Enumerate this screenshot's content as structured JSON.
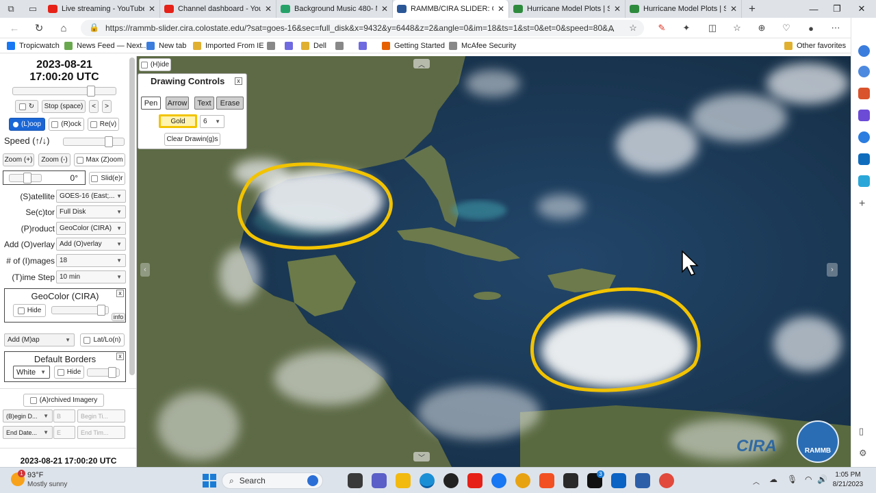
{
  "browser": {
    "tabs": [
      {
        "title": "Live streaming - YouTube Stu",
        "color": "#e62117"
      },
      {
        "title": "Channel dashboard - YouTub",
        "color": "#e62117"
      },
      {
        "title": "Background Music 480- Mus",
        "color": "#26a269"
      },
      {
        "title": "RAMMB/CIRA SLIDER: GOES-",
        "color": "#2b5797",
        "active": true
      },
      {
        "title": "Hurricane Model Plots | Sou",
        "color": "#2e8b3e"
      },
      {
        "title": "Hurricane Model Plots | Sou",
        "color": "#2e8b3e"
      }
    ],
    "new_tab": "+",
    "url": "https://rammb-slider.cira.colostate.edu/?sat=goes-16&sec=full_disk&x=9432&y=6448&z=2&angle=0&im=18&ts=1&st=0&et=0&speed=80&...",
    "bookmarks": [
      {
        "label": "Tropicwatch",
        "color": "#1877f2"
      },
      {
        "label": "News Feed — Next...",
        "color": "#6aa84f"
      },
      {
        "label": "New tab",
        "color": "#3b7ddd"
      },
      {
        "label": "Imported From IE",
        "color": "#e0b030"
      },
      {
        "label": "",
        "color": "#888"
      },
      {
        "label": "",
        "color": "#6f6ae0"
      },
      {
        "label": "Dell",
        "color": "#e0b030"
      },
      {
        "label": "",
        "color": "#888"
      },
      {
        "label": "",
        "color": "#6f6ae0"
      },
      {
        "label": "Getting Started",
        "color": "#e66000"
      },
      {
        "label": "McAfee Security",
        "color": "#888"
      }
    ],
    "other_favorites": "Other favorites"
  },
  "panel": {
    "date": "2023-08-21",
    "time": "17:00:20 UTC",
    "stop_label": "Stop (space)",
    "prev": "<",
    "next": ">",
    "loop": "(L)oop",
    "rock": "(R)ock",
    "rev": "Re(v)",
    "speed_label": "Speed (↑/↓)",
    "zoom_in": "Zoom (+)",
    "zoom_out": "Zoom (-)",
    "max_zoom": "Max (Z)oom",
    "angle": "0°",
    "slider_btn": "Slid(e)r",
    "satellite_label": "(S)atellite",
    "satellite_value": "GOES-16 (East;...",
    "sector_label": "Se(c)tor",
    "sector_value": "Full Disk",
    "product_label": "(P)roduct",
    "product_value": "GeoColor (CIRA)",
    "overlay_label": "Add (O)verlay",
    "overlay_value": "Add (O)verlay",
    "images_label": "# of (I)mages",
    "images_value": "18",
    "timestep_label": "(T)ime Step",
    "timestep_value": "10 min",
    "geocolor_title": "GeoColor (CIRA)",
    "hide": "Hide",
    "info": "info",
    "close": "x",
    "add_map": "Add (M)ap",
    "latlon": "Lat/Lo(n)",
    "borders_title": "Default Borders",
    "borders_color": "White",
    "archived": "(A)rchived Imagery",
    "begin_date": "(B)egin D...",
    "begin_b": "B",
    "begin_time": "Begin Ti...",
    "end_date": "End Date...",
    "end_e": "E",
    "end_time": "End Tim...",
    "footer_time": "2023-08-21 17:00:20 UTC"
  },
  "drawing": {
    "hide_label": "(H)ide",
    "title": "Drawing Controls",
    "close": "x",
    "tools": [
      "Pen",
      "Arrow",
      "Text",
      "Erase"
    ],
    "color": "Gold",
    "size": "6",
    "clear": "Clear Drawin(g)s"
  },
  "map": {
    "logo_text": "CIRA",
    "badge_text": "RAMMB"
  },
  "taskbar": {
    "temp": "93°F",
    "weather": "Mostly sunny",
    "weather_badge": "1",
    "search": "Search",
    "time": "1:05 PM",
    "date": "8/21/2023",
    "notif_badge": "3"
  }
}
